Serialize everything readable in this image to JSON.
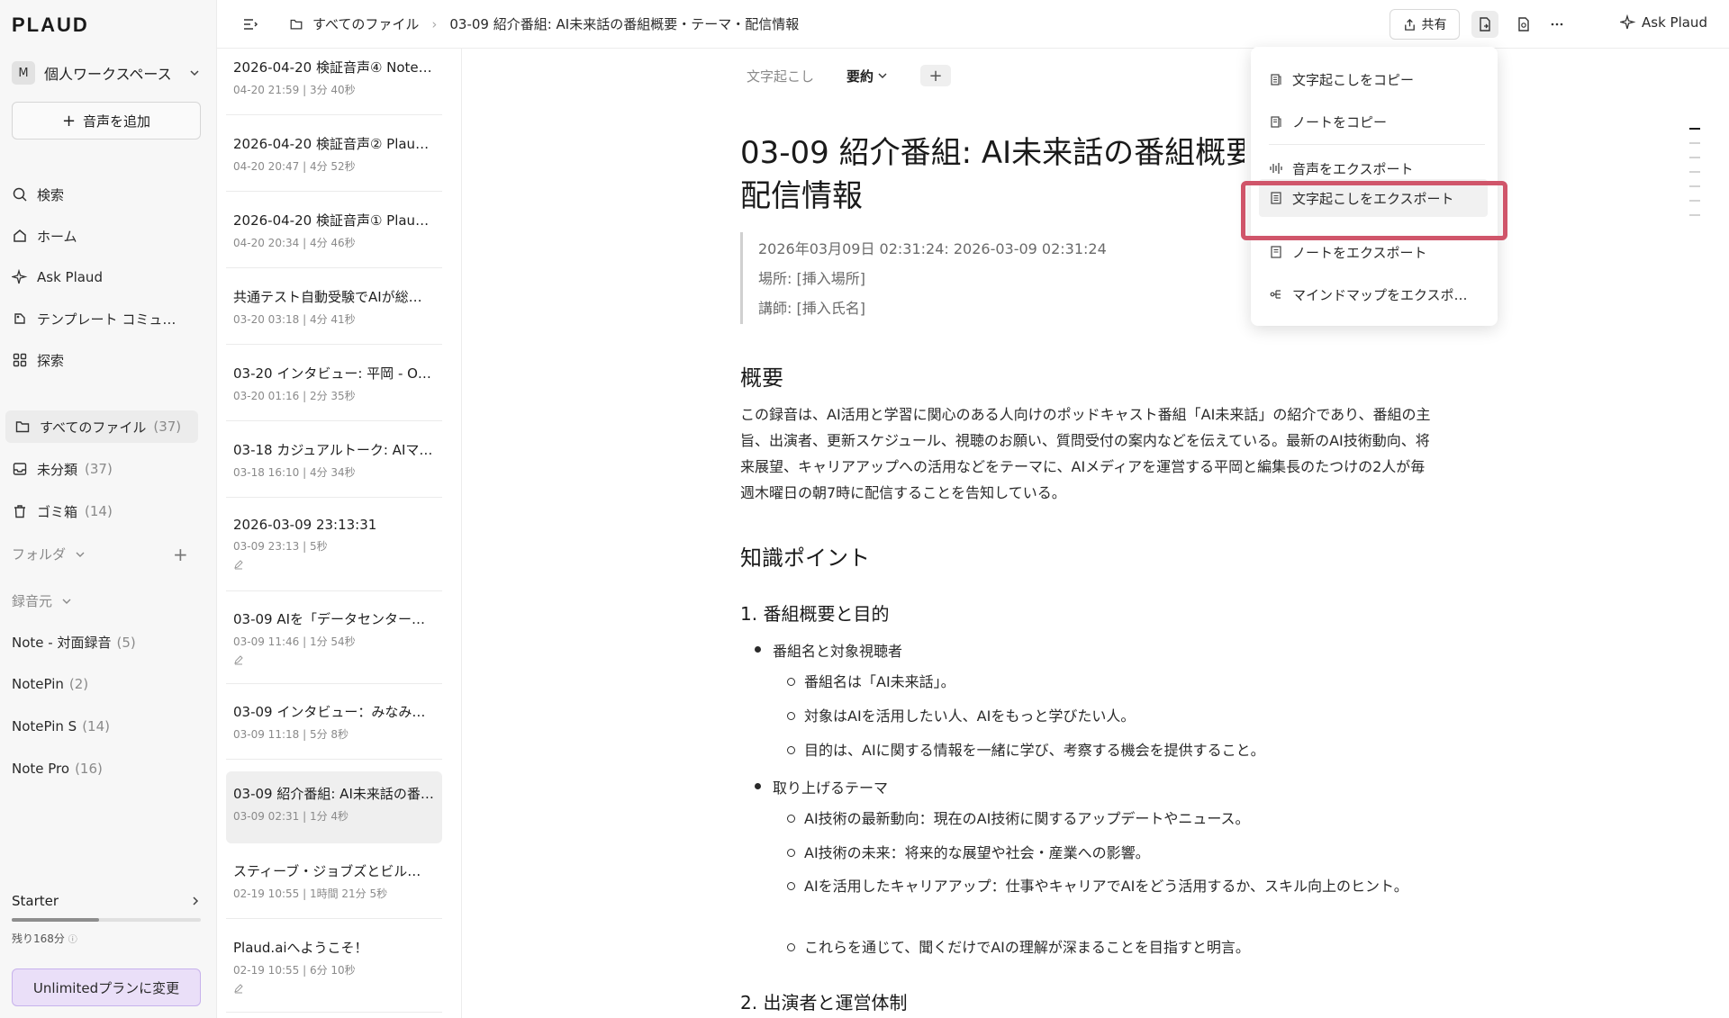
{
  "sidebar": {
    "logo": "PLAUD",
    "workspace": {
      "avatar": "M",
      "name": "個人ワークスペース"
    },
    "add_audio": "音声を追加",
    "nav": [
      {
        "label": "検索",
        "icon": "search-icon"
      },
      {
        "label": "ホーム",
        "icon": "home-icon"
      },
      {
        "label": "Ask Plaud",
        "icon": "sparkle-icon"
      },
      {
        "label": "テンプレート コミュ…",
        "icon": "template-icon"
      },
      {
        "label": "探索",
        "icon": "grid-icon"
      }
    ],
    "files": [
      {
        "label": "すべてのファイル",
        "count": "(37)",
        "icon": "folder-icon"
      },
      {
        "label": "未分類",
        "count": "(37)",
        "icon": "inbox-icon"
      },
      {
        "label": "ゴミ箱",
        "count": "(14)",
        "icon": "trash-icon"
      }
    ],
    "folder_label": "フォルダ",
    "source_label": "録音元",
    "sources": [
      {
        "label": "Note - 対面録音",
        "count": "(5)"
      },
      {
        "label": "NotePin",
        "count": "(2)"
      },
      {
        "label": "NotePin S",
        "count": "(14)"
      },
      {
        "label": "Note Pro",
        "count": "(16)"
      }
    ],
    "plan": {
      "name": "Starter",
      "remaining": "残り168分",
      "usage_fraction": 0.46
    },
    "upgrade": "Unlimitedプランに変更"
  },
  "topbar": {
    "breadcrumb_root": "すべてのファイル",
    "breadcrumb_current": "03-09 紹介番組: AI未来話の番組概要・テーマ・配信情報",
    "share": "共有",
    "ask": "Ask Plaud"
  },
  "filelist": [
    {
      "title": "2026-04-20 検証音声④ Note …",
      "meta": "04-20 21:59 | 3分 40秒",
      "pen": false
    },
    {
      "title": "2026-04-20 検証音声② Plaud…",
      "meta": "04-20 20:47 | 4分 52秒",
      "pen": false
    },
    {
      "title": "2026-04-20 検証音声① Plaud…",
      "meta": "04-20 20:34 | 4分 46秒",
      "pen": false
    },
    {
      "title": "共通テスト自動受験でAIが総…",
      "meta": "03-20 03:18 | 4分 41秒",
      "pen": false
    },
    {
      "title": "03-20 インタビュー: 平岡 - O…",
      "meta": "03-20 01:16 | 2分 35秒",
      "pen": false
    },
    {
      "title": "03-18 カジュアルトーク: AIマ…",
      "meta": "03-18 16:10 | 4分 34秒",
      "pen": false
    },
    {
      "title": "2026-03-09 23:13:31",
      "meta": "03-09 23:13 | 5秒",
      "pen": true
    },
    {
      "title": "03-09 AIを「データセンター…",
      "meta": "03-09 11:46 | 1分 54秒",
      "pen": true
    },
    {
      "title": "03-09 インタビュー：みなみ…",
      "meta": "03-09 11:18 | 5分 8秒",
      "pen": false
    },
    {
      "title": "03-09 紹介番組: AI未来話の番…",
      "meta": "03-09 02:31 | 1分 4秒",
      "pen": false
    },
    {
      "title": "スティーブ・ジョブズとビル…",
      "meta": "02-19 10:55 | 1時間 21分 5秒",
      "pen": false
    },
    {
      "title": "Plaud.aiへようこそ！",
      "meta": "02-19 10:55 | 6分 10秒",
      "pen": true
    }
  ],
  "doc": {
    "tabs": [
      "文字起こし",
      "要約"
    ],
    "title_line1": "03-09 紹介番組: AI未来話の番組概要・テーマ・",
    "title_line2": "配信情報",
    "meta": [
      "2026年03月09日 02:31:24: 2026-03-09 02:31:24",
      "場所: [挿入場所]",
      "講師: [挿入氏名]"
    ],
    "overview_h": "概要",
    "overview": "この録音は、AI活用と学習に関心のある人向けのポッドキャスト番組「AI未来話」の紹介であり、番組の主旨、出演者、更新スケジュール、視聴のお願い、質問受付の案内などを伝えている。最新のAI技術動向、将来展望、キャリアアップへの活用などをテーマに、AIメディアを運営する平岡と編集長のたつけの2人が毎週木曜日の朝7時に配信することを告知している。",
    "kp_h": "知識ポイント",
    "s1": "1. 番組概要と目的",
    "b1": "番組名と対象視聴者",
    "b1_items": [
      "番組名は「AI未来話」。",
      "対象はAIを活用したい人、AIをもっと学びたい人。",
      "目的は、AIに関する情報を一緒に学び、考察する機会を提供すること。"
    ],
    "b2": "取り上げるテーマ",
    "b2_items": [
      "AI技術の最新動向：現在のAI技術に関するアップデートやニュース。",
      "AI技術の未来：将来的な展望や社会・産業への影響。",
      "AIを活用したキャリアアップ：仕事やキャリアでAIをどう活用するか、スキル向上のヒント。",
      "これらを通じて、聞くだけでAIの理解が深まることを目指すと明言。"
    ],
    "s2": "2. 出演者と運営体制"
  },
  "menu": [
    {
      "label": "文字起こしをコピー",
      "icon": "copy-doc-icon"
    },
    {
      "label": "ノートをコピー",
      "icon": "copy-note-icon"
    },
    {
      "label": "音声をエクスポート",
      "icon": "waveform-icon"
    },
    {
      "label": "文字起こしをエクスポート",
      "icon": "export-doc-icon"
    },
    {
      "label": "ノートをエクスポート",
      "icon": "export-note-icon"
    },
    {
      "label": "マインドマップをエクスポ…",
      "icon": "mindmap-icon"
    }
  ],
  "colors": {
    "highlight": "#d0556a",
    "upgrade_bg": "#eadff8"
  }
}
